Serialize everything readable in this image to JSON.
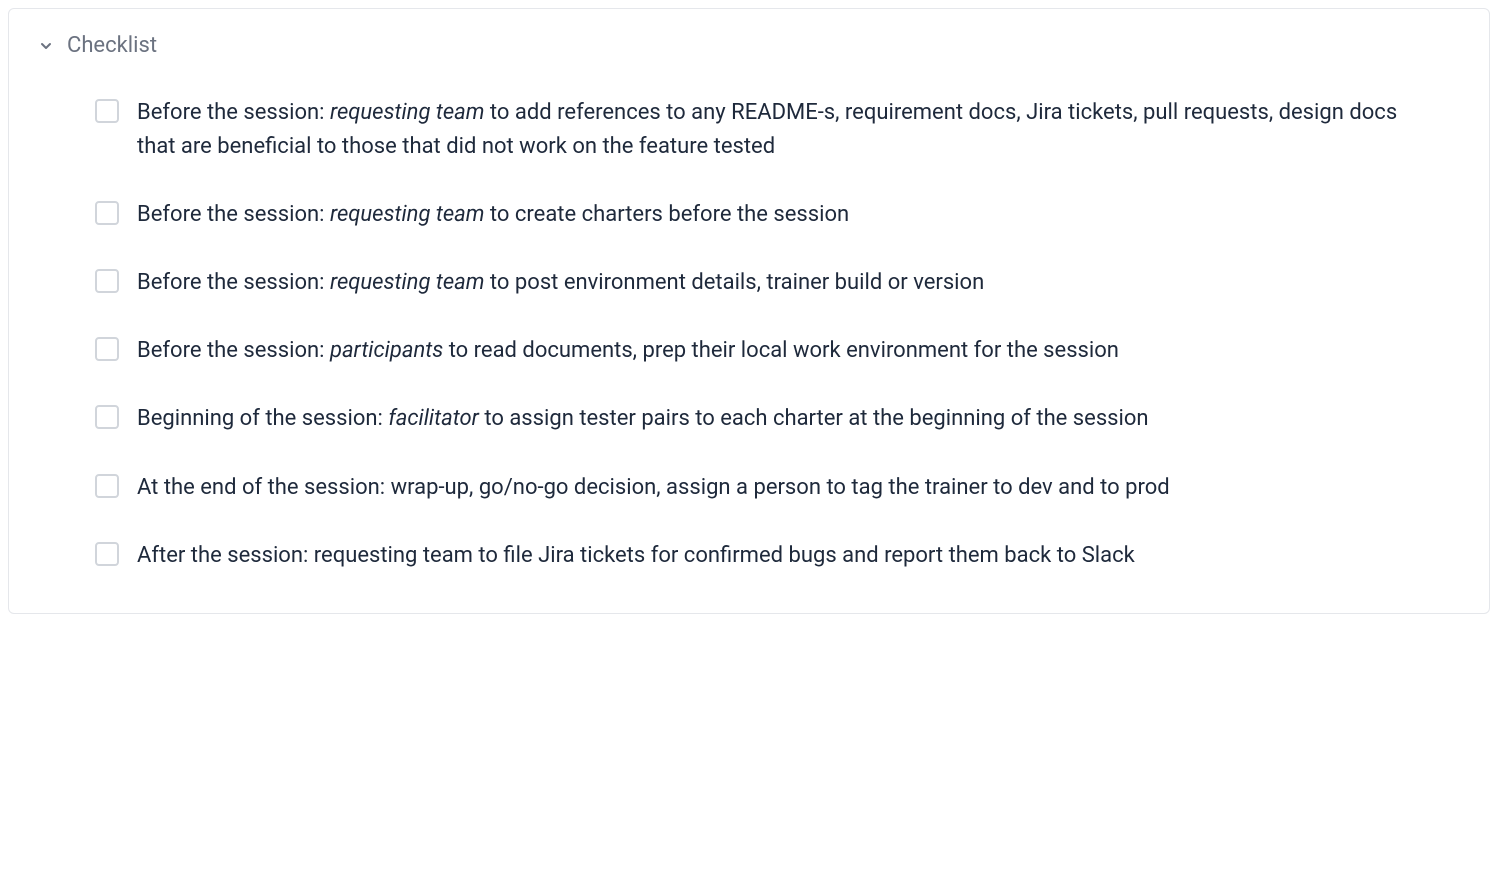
{
  "panel": {
    "title": "Checklist"
  },
  "items": [
    {
      "prefix": "Before the session: ",
      "role": "requesting team",
      "suffix": " to add references to any README-s, requirement docs, Jira tickets, pull requests, design docs that are beneficial to those that did not work on the feature tested"
    },
    {
      "prefix": "Before the session: ",
      "role": "requesting team",
      "suffix": " to create charters before the session"
    },
    {
      "prefix": "Before the session: ",
      "role": "requesting team",
      "suffix": " to post environment details, trainer build or version"
    },
    {
      "prefix": "Before the session: ",
      "role": "participants",
      "suffix": " to read documents, prep their local work environment for the session"
    },
    {
      "prefix": "Beginning of the session: ",
      "role": "facilitator",
      "suffix": " to assign tester pairs to each charter at the beginning of the session"
    },
    {
      "prefix": "At the end of the session: wrap-up, go/no-go decision, assign a person to tag the trainer to dev and to prod",
      "role": "",
      "suffix": ""
    },
    {
      "prefix": "After the session: requesting team to file Jira tickets for confirmed bugs and report them back to Slack",
      "role": "",
      "suffix": ""
    }
  ]
}
